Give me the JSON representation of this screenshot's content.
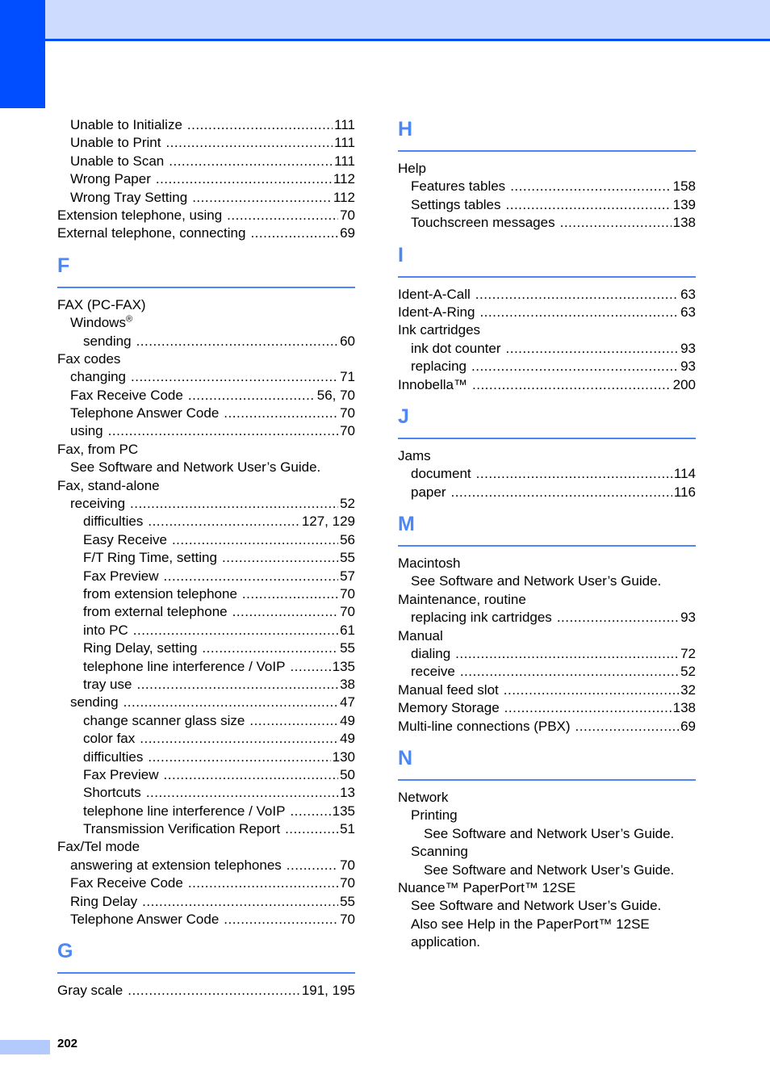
{
  "page": {
    "number": "202",
    "colors": {
      "tab": "#004eff",
      "band": "#cddcfe",
      "accent": "#4d87f5"
    }
  },
  "left": {
    "continuation": [
      {
        "level": 1,
        "term": "Unable to Initialize",
        "pages": "111"
      },
      {
        "level": 1,
        "term": "Unable to Print",
        "pages": "111"
      },
      {
        "level": 1,
        "term": "Unable to Scan",
        "pages": "111"
      },
      {
        "level": 1,
        "term": "Wrong Paper",
        "pages": "112"
      },
      {
        "level": 1,
        "term": "Wrong Tray Setting",
        "pages": "112"
      },
      {
        "level": 0,
        "term": "Extension telephone, using",
        "pages": "70"
      },
      {
        "level": 0,
        "term": "External telephone, connecting",
        "pages": "69"
      }
    ],
    "sections": [
      {
        "letter": "F",
        "entries": [
          {
            "level": 0,
            "term": "FAX (PC-FAX)",
            "pages": ""
          },
          {
            "level": 1,
            "term": "Windows",
            "sup": "®",
            "pages": ""
          },
          {
            "level": 2,
            "term": "sending",
            "pages": "60"
          },
          {
            "level": 0,
            "term": "Fax codes",
            "pages": ""
          },
          {
            "level": 1,
            "term": "changing",
            "pages": "71"
          },
          {
            "level": 1,
            "term": "Fax Receive Code",
            "pages": "56, 70"
          },
          {
            "level": 1,
            "term": "Telephone Answer Code",
            "pages": "70"
          },
          {
            "level": 1,
            "term": "using",
            "pages": "70"
          },
          {
            "level": 0,
            "term": "Fax, from PC",
            "pages": ""
          },
          {
            "level": 1,
            "term": "See Software and Network User’s Guide.",
            "pages": ""
          },
          {
            "level": 0,
            "term": "Fax, stand-alone",
            "pages": ""
          },
          {
            "level": 1,
            "term": "receiving",
            "pages": "52"
          },
          {
            "level": 2,
            "term": "difficulties",
            "pages": "127, 129"
          },
          {
            "level": 2,
            "term": "Easy Receive",
            "pages": "56"
          },
          {
            "level": 2,
            "term": "F/T Ring Time, setting",
            "pages": "55"
          },
          {
            "level": 2,
            "term": "Fax Preview",
            "pages": "57"
          },
          {
            "level": 2,
            "term": "from extension telephone",
            "pages": "70"
          },
          {
            "level": 2,
            "term": "from external telephone",
            "pages": "70"
          },
          {
            "level": 2,
            "term": "into PC",
            "pages": "61"
          },
          {
            "level": 2,
            "term": "Ring Delay, setting",
            "pages": "55"
          },
          {
            "level": 2,
            "term": "telephone line interference / VoIP",
            "pages": "135"
          },
          {
            "level": 2,
            "term": "tray use",
            "pages": "38"
          },
          {
            "level": 1,
            "term": "sending",
            "pages": "47"
          },
          {
            "level": 2,
            "term": "change scanner glass size",
            "pages": "49"
          },
          {
            "level": 2,
            "term": "color fax",
            "pages": "49"
          },
          {
            "level": 2,
            "term": "difficulties",
            "pages": "130"
          },
          {
            "level": 2,
            "term": "Fax Preview",
            "pages": "50"
          },
          {
            "level": 2,
            "term": "Shortcuts",
            "pages": "13"
          },
          {
            "level": 2,
            "term": "telephone line interference / VoIP",
            "pages": "135"
          },
          {
            "level": 2,
            "term": "Transmission Verification Report",
            "pages": "51"
          },
          {
            "level": 0,
            "term": "Fax/Tel mode",
            "pages": ""
          },
          {
            "level": 1,
            "term": "answering at extension telephones",
            "pages": "70"
          },
          {
            "level": 1,
            "term": "Fax Receive Code",
            "pages": "70"
          },
          {
            "level": 1,
            "term": "Ring Delay",
            "pages": "55"
          },
          {
            "level": 1,
            "term": "Telephone Answer Code",
            "pages": "70"
          }
        ]
      },
      {
        "letter": "G",
        "entries": [
          {
            "level": 0,
            "term": "Gray scale",
            "pages": "191, 195"
          }
        ]
      }
    ]
  },
  "right": {
    "sections": [
      {
        "letter": "H",
        "entries": [
          {
            "level": 0,
            "term": "Help",
            "pages": ""
          },
          {
            "level": 1,
            "term": "Features tables",
            "pages": "158"
          },
          {
            "level": 1,
            "term": "Settings tables",
            "pages": "139"
          },
          {
            "level": 1,
            "term": "Touchscreen messages",
            "pages": "138"
          }
        ]
      },
      {
        "letter": "I",
        "entries": [
          {
            "level": 0,
            "term": "Ident-A-Call",
            "pages": "63"
          },
          {
            "level": 0,
            "term": "Ident-A-Ring",
            "pages": "63"
          },
          {
            "level": 0,
            "term": "Ink cartridges",
            "pages": ""
          },
          {
            "level": 1,
            "term": "ink dot counter",
            "pages": "93"
          },
          {
            "level": 1,
            "term": "replacing",
            "pages": "93"
          },
          {
            "level": 0,
            "term": "Innobella™",
            "pages": "200"
          }
        ]
      },
      {
        "letter": "J",
        "entries": [
          {
            "level": 0,
            "term": "Jams",
            "pages": ""
          },
          {
            "level": 1,
            "term": "document",
            "pages": "114"
          },
          {
            "level": 1,
            "term": "paper",
            "pages": "116"
          }
        ]
      },
      {
        "letter": "M",
        "entries": [
          {
            "level": 0,
            "term": "Macintosh",
            "pages": ""
          },
          {
            "level": 1,
            "term": "See Software and Network User’s Guide.",
            "pages": ""
          },
          {
            "level": 0,
            "term": "Maintenance, routine",
            "pages": ""
          },
          {
            "level": 1,
            "term": "replacing ink cartridges",
            "pages": "93"
          },
          {
            "level": 0,
            "term": "Manual",
            "pages": ""
          },
          {
            "level": 1,
            "term": "dialing",
            "pages": "72"
          },
          {
            "level": 1,
            "term": "receive",
            "pages": "52"
          },
          {
            "level": 0,
            "term": "Manual feed slot",
            "pages": "32"
          },
          {
            "level": 0,
            "term": "Memory Storage",
            "pages": "138"
          },
          {
            "level": 0,
            "term": "Multi-line connections (PBX)",
            "pages": "69"
          }
        ]
      },
      {
        "letter": "N",
        "entries": [
          {
            "level": 0,
            "term": "Network",
            "pages": ""
          },
          {
            "level": 1,
            "term": "Printing",
            "pages": ""
          },
          {
            "level": 2,
            "term": "See Software and Network User’s Guide.",
            "pages": ""
          },
          {
            "level": 1,
            "term": "Scanning",
            "pages": ""
          },
          {
            "level": 2,
            "term": "See Software and Network User’s Guide.",
            "pages": ""
          },
          {
            "level": 0,
            "term": "Nuance™ PaperPort™ 12SE",
            "pages": ""
          },
          {
            "level": 1,
            "term": "See Software and Network User’s Guide.",
            "pages": ""
          },
          {
            "level": 1,
            "term": "Also see Help in the PaperPort™ 12SE",
            "pages": ""
          },
          {
            "level": 1,
            "term": "application.",
            "pages": ""
          }
        ]
      }
    ]
  }
}
